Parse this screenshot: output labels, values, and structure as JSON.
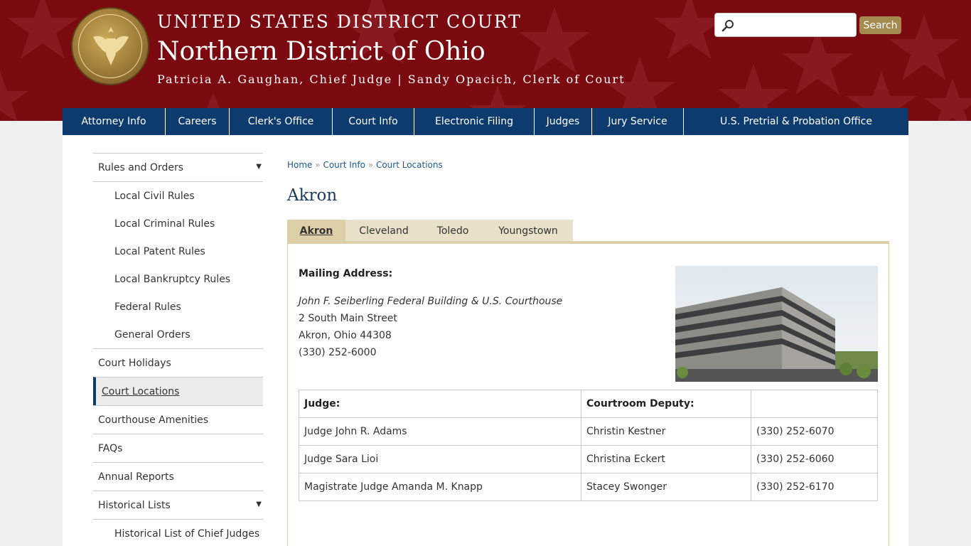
{
  "header": {
    "line1": "UNITED STATES DISTRICT COURT",
    "line2": "Northern District of Ohio",
    "line3": "Patricia A. Gaughan, Chief Judge | Sandy Opacich, Clerk of Court",
    "seal_text": "UNITED STATES DISTRICT COURT · NORTHERN DISTRICT OF OHIO",
    "search_placeholder": "",
    "search_label": "Search",
    "brand_color": "#7a0a10",
    "nav_color": "#0d3b6e"
  },
  "nav": {
    "items": [
      {
        "label": "Attorney Info"
      },
      {
        "label": "Careers"
      },
      {
        "label": "Clerk's Office"
      },
      {
        "label": "Court Info"
      },
      {
        "label": "Electronic Filing"
      },
      {
        "label": "Judges"
      },
      {
        "label": "Jury Service"
      },
      {
        "label": "U.S. Pretrial & Probation Office"
      }
    ]
  },
  "sidebar": {
    "items": [
      {
        "label": "Rules and Orders",
        "expandable": true
      },
      {
        "label": "Local Civil Rules",
        "sub": true
      },
      {
        "label": "Local Criminal Rules",
        "sub": true
      },
      {
        "label": "Local Patent Rules",
        "sub": true
      },
      {
        "label": "Local Bankruptcy Rules",
        "sub": true
      },
      {
        "label": "Federal Rules",
        "sub": true
      },
      {
        "label": "General Orders",
        "sub": true
      },
      {
        "label": "Court Holidays"
      },
      {
        "label": "Court Locations",
        "active": true
      },
      {
        "label": "Courthouse Amenities"
      },
      {
        "label": "FAQs"
      },
      {
        "label": "Annual Reports"
      },
      {
        "label": "Historical Lists",
        "expandable": true
      },
      {
        "label": "Historical List of Chief Judges",
        "sub": true
      }
    ],
    "arrow_glyph": "▼"
  },
  "breadcrumb": {
    "home": "Home",
    "sep": "»",
    "court_info": "Court Info",
    "current": "Court Locations"
  },
  "page_title": "Akron",
  "tabs": [
    {
      "label": "Akron",
      "active": true
    },
    {
      "label": "Cleveland"
    },
    {
      "label": "Toledo"
    },
    {
      "label": "Youngstown"
    }
  ],
  "location": {
    "mailing_label": "Mailing Address:",
    "building_name": "John F. Seiberling Federal Building & U.S. Courthouse",
    "street": "2 South Main Street",
    "city": "Akron, Ohio 44308",
    "phone": "(330) 252-6000"
  },
  "judges_table": {
    "headers": [
      "Judge:",
      "Courtroom Deputy:",
      ""
    ],
    "rows": [
      [
        "Judge John R. Adams",
        "Christin Kestner",
        "(330) 252-6070"
      ],
      [
        "Judge Sara Lioi",
        "Christina Eckert",
        "(330) 252-6060"
      ],
      [
        "Magistrate Judge Amanda M. Knapp",
        "Stacey Swonger",
        "(330) 252-6170"
      ]
    ]
  }
}
